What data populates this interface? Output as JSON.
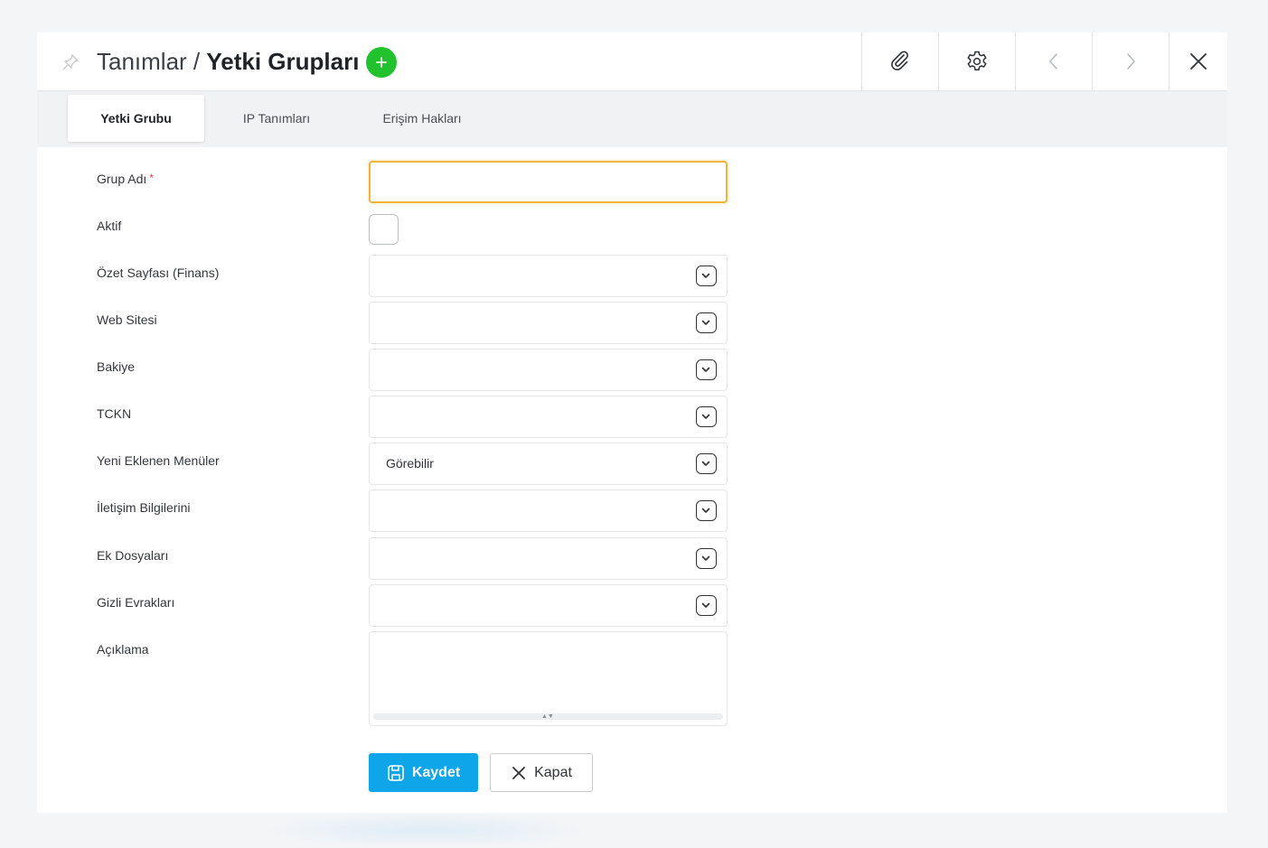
{
  "header": {
    "breadcrumb_parent": "Tanımlar",
    "breadcrumb_separator": " / ",
    "title": "Yetki Grupları",
    "add_icon": "plus-icon",
    "toolbar_icons": [
      "paperclip-icon",
      "gear-icon",
      "chevron-left-icon",
      "chevron-right-icon",
      "close-icon"
    ]
  },
  "tabs": [
    {
      "label": "Yetki Grubu",
      "active": true
    },
    {
      "label": "IP Tanımları",
      "active": false
    },
    {
      "label": "Erişim Hakları",
      "active": false
    }
  ],
  "form": {
    "group_name": {
      "label": "Grup Adı",
      "required_mark": "*",
      "value": ""
    },
    "active": {
      "label": "Aktif",
      "checked": false
    },
    "selects": [
      {
        "label": "Özet Sayfası (Finans)",
        "value": ""
      },
      {
        "label": "Web Sitesi",
        "value": ""
      },
      {
        "label": "Bakiye",
        "value": ""
      },
      {
        "label": "TCKN",
        "value": ""
      },
      {
        "label": "Yeni Eklenen Menüler",
        "value": "Görebilir"
      },
      {
        "label": "İletişim Bilgilerini",
        "value": ""
      },
      {
        "label": "Ek Dosyaları",
        "value": ""
      },
      {
        "label": "Gizli Evrakları",
        "value": ""
      }
    ],
    "description": {
      "label": "Açıklama",
      "value": ""
    }
  },
  "actions": {
    "save_label": "Kaydet",
    "close_label": "Kapat"
  },
  "colors": {
    "accent_blue": "#0ea5e9",
    "add_green": "#22c22e",
    "focus_orange": "#f3b23c",
    "required_red": "#e0443a"
  }
}
